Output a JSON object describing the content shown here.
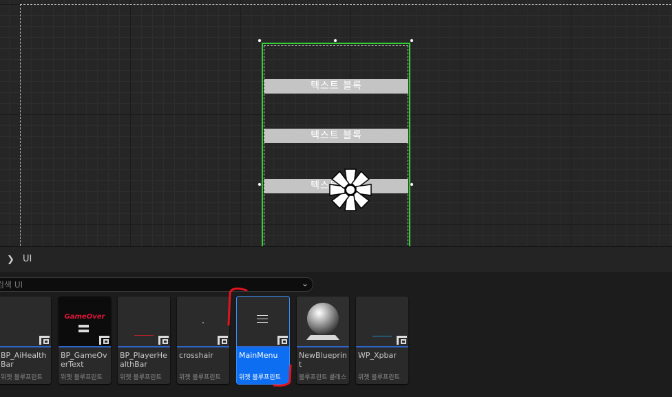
{
  "designer": {
    "text_blocks": [
      "텍스트 블록",
      "텍스트 블록",
      "텍스트 블록"
    ]
  },
  "content_browser": {
    "path": "UI",
    "search_placeholder": "검색 UI",
    "assets": [
      {
        "name": "BP_AiHealthBar",
        "type": "위젯 블루프린트",
        "thumbnail": "blank",
        "selected": false
      },
      {
        "name": "BP_GameOverText",
        "type": "위젯 블루프린트",
        "thumbnail": "gameover-text",
        "thumb_text": "GameOver",
        "selected": false
      },
      {
        "name": "BP_PlayerHealthBar",
        "type": "위젯 블루프린트",
        "thumbnail": "red-bar",
        "selected": false
      },
      {
        "name": "crosshair",
        "type": "위젯 블루프린트",
        "thumbnail": "dot",
        "selected": false
      },
      {
        "name": "MainMenu",
        "type": "위젯 블루프린트",
        "thumbnail": "menu-lines",
        "selected": true
      },
      {
        "name": "NewBlueprint",
        "type": "블루프린트 클래스",
        "thumbnail": "sphere",
        "selected": false
      },
      {
        "name": "WP_Xpbar",
        "type": "위젯 블루프린트",
        "thumbnail": "blue-bar",
        "selected": false
      }
    ]
  },
  "colors": {
    "selection_green": "#2fd22f",
    "selected_tile": "#0d6ef2",
    "annotation_red": "#e0141e"
  }
}
